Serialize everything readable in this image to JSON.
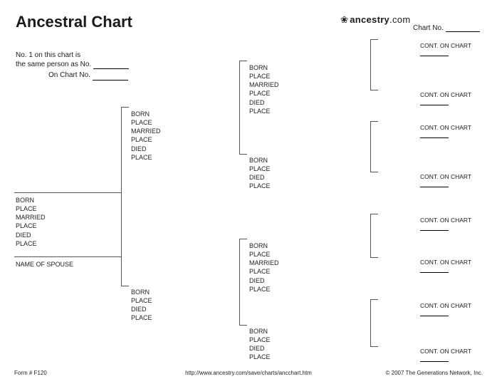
{
  "title": "Ancestral Chart",
  "brand": {
    "name": "ancestry",
    "tld": ".com",
    "leaf": "❀"
  },
  "chartNo": {
    "label": "Chart No."
  },
  "note": {
    "line1": "No. 1 on this chart is",
    "line2": "the same person as No.",
    "onChart": "On Chart No."
  },
  "fields_full": {
    "born": "BORN",
    "place1": "PLACE",
    "married": "MARRIED",
    "place2": "PLACE",
    "died": "DIED",
    "place3": "PLACE"
  },
  "fields_short": {
    "born": "BORN",
    "place1": "PLACE",
    "died": "DIED",
    "place2": "PLACE"
  },
  "spouse_label": "NAME OF SPOUSE",
  "cont_label": "CONT. ON CHART",
  "footer": {
    "form": "Form # F120",
    "url": "http://www.ancestry.com/save/charts/ancchart.htm",
    "copyright": "© 2007 The Generations Network, Inc."
  }
}
